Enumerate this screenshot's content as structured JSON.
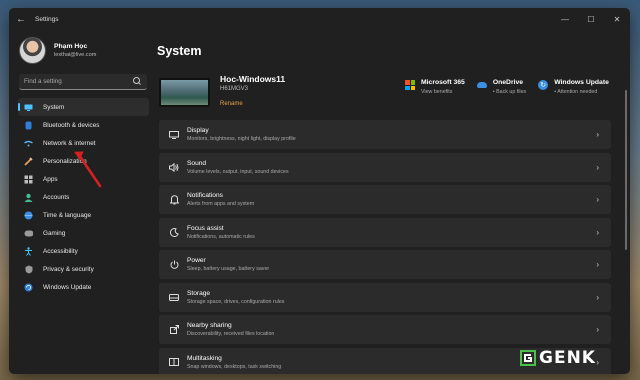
{
  "window": {
    "title": "Settings",
    "controls": {
      "minimize": "—",
      "maximize": "☐",
      "close": "✕"
    }
  },
  "profile": {
    "name": "Phạm Học",
    "email": "lexthai@live.com"
  },
  "search": {
    "placeholder": "Find a setting",
    "icon": "search-icon"
  },
  "sidebar": {
    "items": [
      {
        "label": "System",
        "icon": "system-icon",
        "active": true
      },
      {
        "label": "Bluetooth & devices",
        "icon": "bluetooth-icon"
      },
      {
        "label": "Network & internet",
        "icon": "network-icon"
      },
      {
        "label": "Personalization",
        "icon": "brush-icon"
      },
      {
        "label": "Apps",
        "icon": "apps-icon"
      },
      {
        "label": "Accounts",
        "icon": "accounts-icon"
      },
      {
        "label": "Time & language",
        "icon": "globe-icon"
      },
      {
        "label": "Gaming",
        "icon": "gaming-icon"
      },
      {
        "label": "Accessibility",
        "icon": "accessibility-icon"
      },
      {
        "label": "Privacy & security",
        "icon": "shield-icon"
      },
      {
        "label": "Windows Update",
        "icon": "windows-update-icon"
      }
    ]
  },
  "main": {
    "title": "System",
    "device": {
      "name": "Hoc-Windows11",
      "model": "H61MGV3",
      "rename": "Rename"
    },
    "services": [
      {
        "title": "Microsoft 365",
        "subtitle": "View benefits",
        "icon": "microsoft-365-icon"
      },
      {
        "title": "OneDrive",
        "subtitle": "• Back up files",
        "icon": "onedrive-icon"
      },
      {
        "title": "Windows Update",
        "subtitle": "• Attention needed",
        "icon": "windows-update-icon"
      }
    ],
    "settings": [
      {
        "title": "Display",
        "desc": "Monitors, brightness, night light, display profile",
        "icon": "display-icon"
      },
      {
        "title": "Sound",
        "desc": "Volume levels, output, input, sound devices",
        "icon": "sound-icon"
      },
      {
        "title": "Notifications",
        "desc": "Alerts from apps and system",
        "icon": "bell-icon"
      },
      {
        "title": "Focus assist",
        "desc": "Notifications, automatic rules",
        "icon": "moon-icon"
      },
      {
        "title": "Power",
        "desc": "Sleep, battery usage, battery saver",
        "icon": "power-icon"
      },
      {
        "title": "Storage",
        "desc": "Storage space, drives, configuration rules",
        "icon": "storage-icon"
      },
      {
        "title": "Nearby sharing",
        "desc": "Discoverability, received files location",
        "icon": "share-icon"
      },
      {
        "title": "Multitasking",
        "desc": "Snap windows, desktops, task switching",
        "icon": "multitasking-icon"
      }
    ]
  },
  "watermark": {
    "text": "GENK"
  },
  "colors": {
    "accent": "#4cc2ff",
    "rename": "#e8a14a",
    "arrow": "#d42020",
    "window": "#202020",
    "card": "#2b2b2b"
  }
}
